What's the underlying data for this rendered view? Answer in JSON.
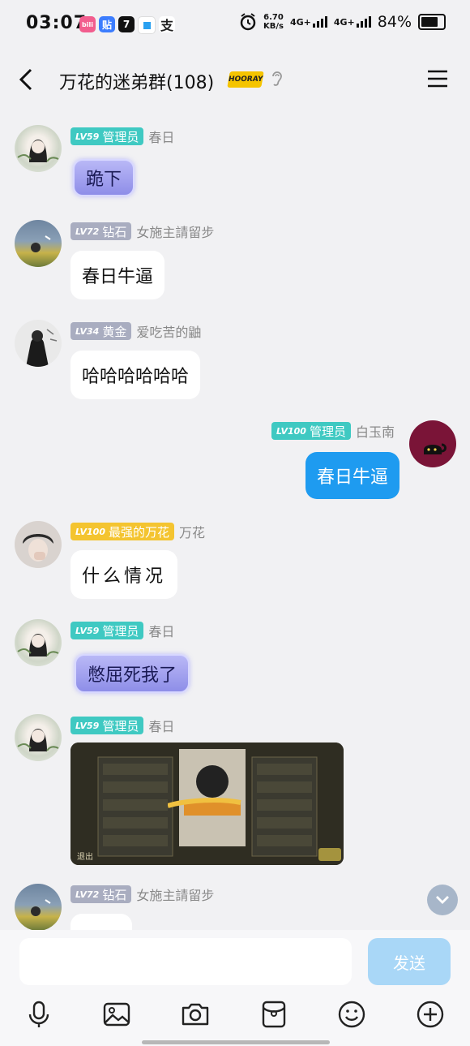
{
  "status_bar": {
    "time": "03:07",
    "app_icons": [
      {
        "name": "bilibili-icon",
        "label": "bili",
        "color": "#f25d8e"
      },
      {
        "name": "tieba-icon",
        "label": "贴",
        "color": "#3c7dfe"
      },
      {
        "name": "app-7-icon",
        "label": "7",
        "color": "#111111"
      },
      {
        "name": "app-square-icon",
        "label": "",
        "color": "#2aa0f0"
      },
      {
        "name": "alipay-icon",
        "label": "支",
        "color": "#1677ff"
      }
    ],
    "net_speed_value": "6.70",
    "net_speed_unit": "KB/s",
    "signal_1": "4G+",
    "signal_2": "4G+",
    "battery": "84%"
  },
  "header": {
    "title": "万花的迷弟群(108)",
    "tag": "HOORAY"
  },
  "messages": [
    {
      "level": "59",
      "rank": "管理员",
      "name": "春日",
      "text": "跪下"
    },
    {
      "level": "72",
      "rank": "钻石",
      "name": "女施主請留步",
      "text": "春日牛逼"
    },
    {
      "level": "34",
      "rank": "黄金",
      "name": "爱吃苦的鼬",
      "text": "哈哈哈哈哈哈"
    },
    {
      "level": "100",
      "rank": "管理员",
      "name": "白玉南",
      "text": "春日牛逼"
    },
    {
      "level": "100",
      "rank": "最强的万花",
      "name": "万花",
      "text": "什么情况"
    },
    {
      "level": "59",
      "rank": "管理员",
      "name": "春日",
      "text": "憋屈死我了"
    },
    {
      "level": "59",
      "rank": "管理员",
      "name": "春日",
      "image_caption": "退出"
    },
    {
      "level": "72",
      "rank": "钻石",
      "name": "女施主請留步",
      "text": ""
    }
  ],
  "lv_prefix": "LV",
  "input": {
    "placeholder": "",
    "send_label": "发送"
  },
  "colors": {
    "admin_badge": "#3fc9c2",
    "rank_badge": "#a9adc0",
    "gold_badge": "#f4c430",
    "self_bubble": "#1e9bf0",
    "send_button": "#a9d7f7"
  }
}
